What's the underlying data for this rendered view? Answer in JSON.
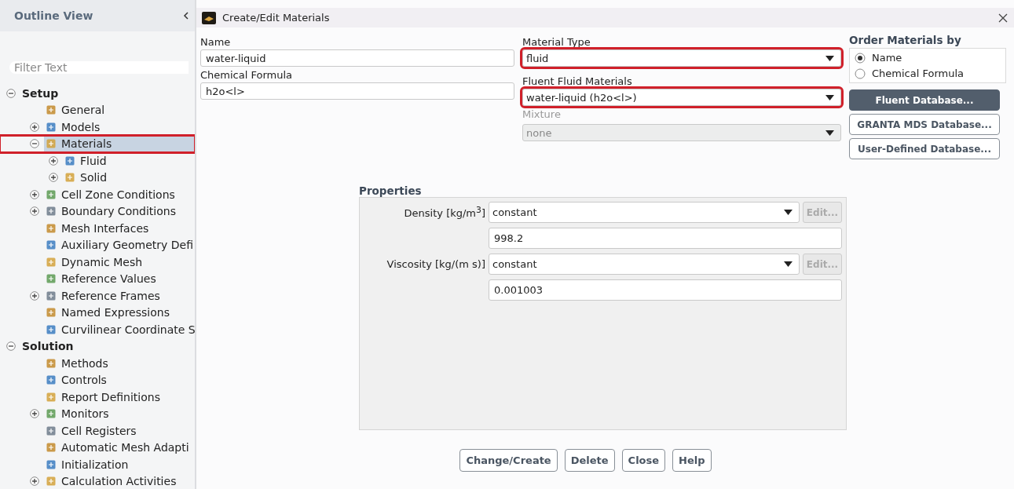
{
  "sidebar": {
    "title": "Outline View",
    "filter": {
      "placeholder": "Filter Text"
    },
    "tree": [
      {
        "label": "Setup",
        "kind": "branch",
        "expanded": true,
        "selected": false,
        "highlighted": false,
        "children": [
          {
            "label": "General",
            "kind": "leaf",
            "selected": false,
            "highlighted": false
          },
          {
            "label": "Models",
            "kind": "branch",
            "expanded": false,
            "selected": false,
            "highlighted": false
          },
          {
            "label": "Materials",
            "kind": "branch",
            "expanded": true,
            "selected": true,
            "highlighted": true,
            "children": [
              {
                "label": "Fluid",
                "kind": "branch",
                "expanded": false,
                "selected": false,
                "highlighted": false
              },
              {
                "label": "Solid",
                "kind": "branch",
                "expanded": false,
                "selected": false,
                "highlighted": false
              }
            ]
          },
          {
            "label": "Cell Zone Conditions",
            "kind": "branch",
            "expanded": false,
            "selected": false,
            "highlighted": false
          },
          {
            "label": "Boundary Conditions",
            "kind": "branch",
            "expanded": false,
            "selected": false,
            "highlighted": false
          },
          {
            "label": "Mesh Interfaces",
            "kind": "leaf",
            "selected": false,
            "highlighted": false
          },
          {
            "label": "Auxiliary Geometry Defi",
            "kind": "leaf",
            "selected": false,
            "highlighted": false
          },
          {
            "label": "Dynamic Mesh",
            "kind": "leaf",
            "selected": false,
            "highlighted": false
          },
          {
            "label": "Reference Values",
            "kind": "leaf",
            "selected": false,
            "highlighted": false
          },
          {
            "label": "Reference Frames",
            "kind": "branch",
            "expanded": false,
            "selected": false,
            "highlighted": false
          },
          {
            "label": "Named Expressions",
            "kind": "leaf",
            "selected": false,
            "highlighted": false
          },
          {
            "label": "Curvilinear Coordinate S",
            "kind": "leaf",
            "selected": false,
            "highlighted": false
          }
        ]
      },
      {
        "label": "Solution",
        "kind": "branch",
        "expanded": true,
        "selected": false,
        "highlighted": false,
        "children": [
          {
            "label": "Methods",
            "kind": "leaf",
            "selected": false,
            "highlighted": false
          },
          {
            "label": "Controls",
            "kind": "leaf",
            "selected": false,
            "highlighted": false
          },
          {
            "label": "Report Definitions",
            "kind": "leaf",
            "selected": false,
            "highlighted": false
          },
          {
            "label": "Monitors",
            "kind": "branch",
            "expanded": false,
            "selected": false,
            "highlighted": false
          },
          {
            "label": "Cell Registers",
            "kind": "leaf",
            "selected": false,
            "highlighted": false
          },
          {
            "label": "Automatic Mesh Adapti",
            "kind": "leaf",
            "selected": false,
            "highlighted": false
          },
          {
            "label": "Initialization",
            "kind": "leaf",
            "selected": false,
            "highlighted": false
          },
          {
            "label": "Calculation Activities",
            "kind": "branch",
            "expanded": false,
            "selected": false,
            "highlighted": false
          }
        ]
      }
    ]
  },
  "dialog": {
    "title": "Create/Edit Materials",
    "name": {
      "label": "Name",
      "value": "water-liquid"
    },
    "chemical_formula": {
      "label": "Chemical Formula",
      "value": "h2o<l>"
    },
    "material_type": {
      "label": "Material Type",
      "value": "fluid",
      "disabled": false,
      "highlighted": true
    },
    "fluent_materials": {
      "label": "Fluent Fluid Materials",
      "value": "water-liquid (h2o<l>)",
      "disabled": false,
      "highlighted": true
    },
    "mixture": {
      "label": "Mixture",
      "value": "none",
      "disabled": true,
      "highlighted": false
    },
    "order_by": {
      "title": "Order Materials by",
      "options": [
        {
          "label": "Name",
          "selected": true
        },
        {
          "label": "Chemical Formula",
          "selected": false
        }
      ]
    },
    "database_buttons": [
      {
        "label": "Fluent Database...",
        "primary": true
      },
      {
        "label": "GRANTA MDS Database...",
        "primary": false
      },
      {
        "label": "User-Defined Database...",
        "primary": false
      }
    ],
    "properties": {
      "title": "Properties",
      "rows": [
        {
          "label": "Density [kg/m$^{3}$]",
          "method": "constant",
          "edit_label": "Edit...",
          "edit_disabled": true,
          "value": "998.2"
        },
        {
          "label": "Viscosity [kg/(m s)]",
          "method": "constant",
          "edit_label": "Edit...",
          "edit_disabled": true,
          "value": "0.001003"
        }
      ]
    },
    "buttons": [
      "Change/Create",
      "Delete",
      "Close",
      "Help"
    ]
  }
}
